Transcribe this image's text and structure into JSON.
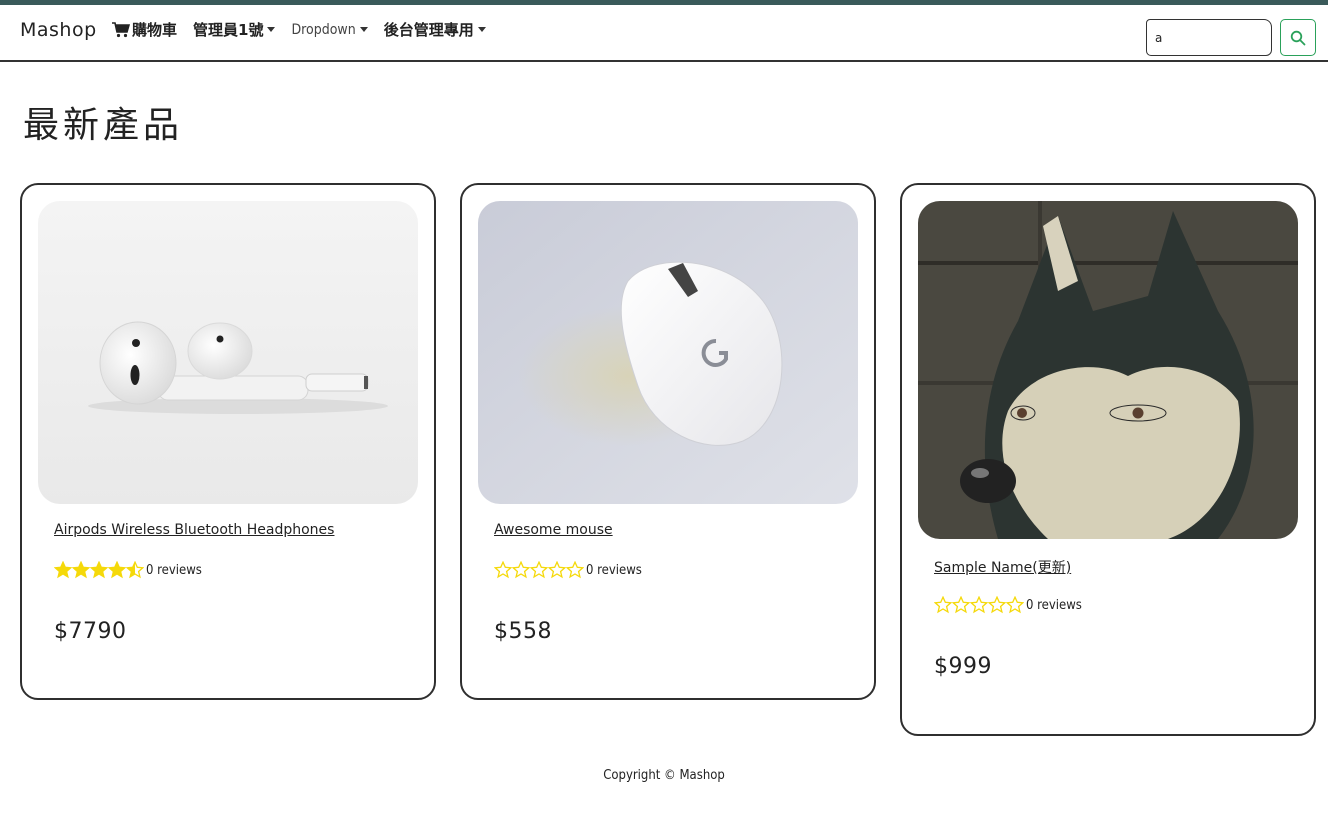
{
  "navbar": {
    "brand": "Mashop",
    "items": [
      {
        "label": "購物車",
        "icon": "cart-icon"
      },
      {
        "label": "管理員1號",
        "dropdown": true
      },
      {
        "label": "Dropdown",
        "dropdown": true
      },
      {
        "label": "後台管理專用",
        "dropdown": true
      }
    ],
    "search": {
      "value": "a"
    }
  },
  "main": {
    "title": "最新產品",
    "products": [
      {
        "name": "Airpods Wireless Bluetooth Headphones",
        "rating": 4.5,
        "reviews": "0 reviews",
        "price": "$7790",
        "image": "airpods"
      },
      {
        "name": "Awesome mouse",
        "rating": 0,
        "reviews": "0 reviews",
        "price": "$558",
        "image": "white-mouse"
      },
      {
        "name": "Sample Name(更新)",
        "rating": 0,
        "reviews": "0 reviews",
        "price": "$999",
        "image": "husky-dog"
      }
    ]
  },
  "footer": {
    "copyright": "Copyright © Mashop"
  },
  "colors": {
    "star": "#f5d90a",
    "search_button": "#2aa15a",
    "border": "#2f2f2f",
    "top_stripe": "#3a5a5a"
  }
}
